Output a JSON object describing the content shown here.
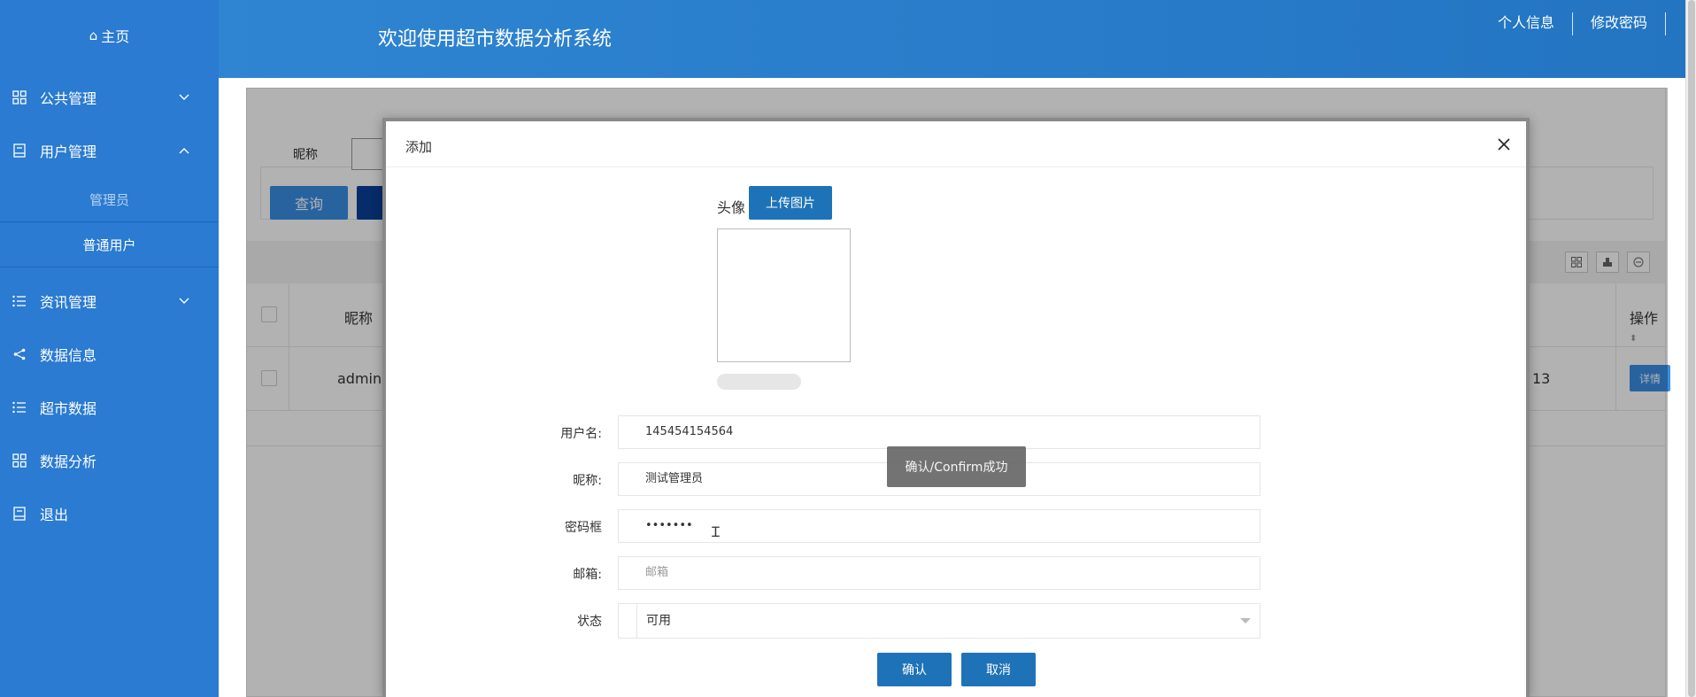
{
  "sidebar": {
    "home_label": "主页",
    "items": [
      {
        "label": "公共管理",
        "icon": "grid-icon",
        "chevron": "down"
      },
      {
        "label": "用户管理",
        "icon": "book-icon",
        "chevron": "up"
      },
      {
        "label": "资讯管理",
        "icon": "list-icon",
        "chevron": "down"
      },
      {
        "label": "数据信息",
        "icon": "share-icon"
      },
      {
        "label": "超市数据",
        "icon": "list-icon"
      },
      {
        "label": "数据分析",
        "icon": "grid-icon"
      },
      {
        "label": "退出",
        "icon": "book-icon"
      }
    ],
    "submenu": [
      "管理员",
      "普通用户"
    ]
  },
  "header": {
    "title": "欢迎使用超市数据分析系统",
    "links": [
      "个人信息",
      "修改密码"
    ]
  },
  "page": {
    "search_label": "昵称",
    "query_button": "查询",
    "table": {
      "header_nick": "昵称",
      "header_op": "操作",
      "rows": [
        {
          "nick": "admin",
          "partial": "13",
          "action": "详情"
        }
      ]
    }
  },
  "dialog": {
    "title": "添加",
    "avatar_label": "头像",
    "upload_button": "上传图片",
    "fields": {
      "username_label": "用户名:",
      "username_value": "145454154564",
      "nickname_label": "昵称:",
      "nickname_value": "测试管理员",
      "password_label": "密码框",
      "password_value": "•••••••",
      "email_label": "邮箱:",
      "email_placeholder": "邮箱",
      "status_label": "状态",
      "status_value": "可用"
    },
    "confirm_button": "确认",
    "cancel_button": "取消",
    "toast": "确认/Confirm成功"
  },
  "colors": {
    "sidebar_bg": "#2a7bd1",
    "header_bg": "#2375c2",
    "primary_button": "#1e73b8"
  }
}
